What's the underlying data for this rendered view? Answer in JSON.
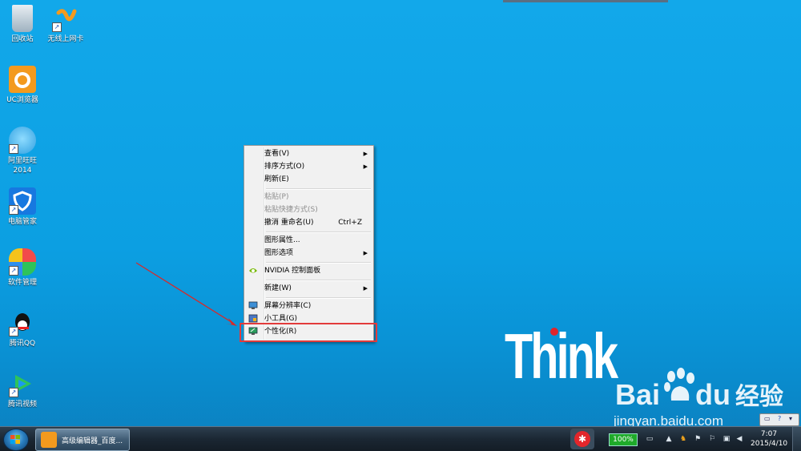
{
  "desktop_icons": [
    {
      "name": "recycle-bin-icon",
      "label": "回收站"
    },
    {
      "name": "wireless-card-icon",
      "label": "无线上网卡"
    },
    {
      "name": "uc-browser-icon",
      "label": "UC浏览器"
    },
    {
      "name": "aliwangwang-icon",
      "label": "阿里旺旺\n2014",
      "line1": "阿里旺旺",
      "line2": "2014"
    },
    {
      "name": "pc-manager-icon",
      "label": "电脑管家"
    },
    {
      "name": "software-manager-icon",
      "label": "软件管理"
    },
    {
      "name": "tencent-qq-icon",
      "label": "腾讯QQ"
    },
    {
      "name": "tencent-video-icon",
      "label": "腾讯视频"
    }
  ],
  "context_menu": {
    "view": "查看(V)",
    "sort_by": "排序方式(O)",
    "refresh": "刷新(E)",
    "paste": "粘贴(P)",
    "paste_shortcut": "粘贴快捷方式(S)",
    "undo_rename": "撤消 重命名(U)",
    "undo_shortcut": "Ctrl+Z",
    "graphics_properties": "图形属性...",
    "graphics_options": "图形选项",
    "nvidia": "NVIDIA 控制面板",
    "new": "新建(W)",
    "screen_resolution": "屏幕分辨率(C)",
    "gadgets": "小工具(G)",
    "personalize": "个性化(R)"
  },
  "wallpaper": {
    "brand": "Think",
    "watermark_main": "Bai",
    "watermark_main2": "du",
    "watermark_cn": "经验",
    "watermark_url": "jingyan.baidu.com"
  },
  "taskbar": {
    "window_title": "高级编辑器_百度...",
    "battery": "100%",
    "time": "7:07",
    "date": "2015/4/10"
  },
  "colors": {
    "desktop_bg": "#12a8ea",
    "highlight_border": "#e23b3b",
    "arrow": "#d62a2a",
    "think_dot": "#e0262b"
  }
}
